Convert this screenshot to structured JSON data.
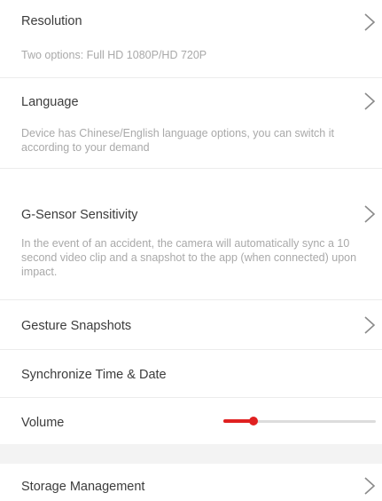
{
  "settings": {
    "resolution": {
      "title": "Resolution",
      "desc": "Two options: Full HD 1080P/HD 720P",
      "chevron_icon": "chevron-right-icon"
    },
    "language": {
      "title": "Language",
      "desc": "Device has Chinese/English language options, you can switch it according to your demand",
      "chevron_icon": "chevron-right-icon"
    },
    "gsensor": {
      "title": "G-Sensor Sensitivity",
      "desc": "In the event of an accident, the camera will automatically sync a 10 second video clip and a snapshot to the app (when connected) upon impact.",
      "chevron_icon": "chevron-right-icon"
    },
    "gesture": {
      "title": "Gesture Snapshots",
      "chevron_icon": "chevron-right-icon"
    },
    "sync_time": {
      "title": "Synchronize Time & Date"
    },
    "volume": {
      "title": "Volume",
      "level": 0.2
    },
    "storage": {
      "title": "Storage Management",
      "chevron_icon": "chevron-right-icon"
    }
  },
  "colors": {
    "accent": "#e02020",
    "title_text": "#3c3c3c",
    "desc_text": "#a9a9a9",
    "divider": "#ececec",
    "section_gap": "#f3f3f3"
  }
}
